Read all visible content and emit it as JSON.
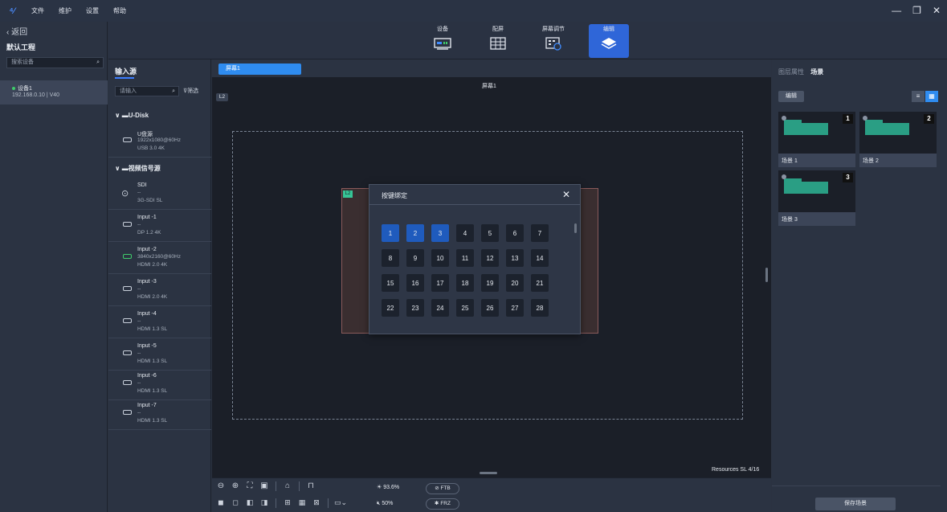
{
  "menu": {
    "items": [
      "文件",
      "维护",
      "设置",
      "帮助"
    ]
  },
  "window": {
    "minimize": "—",
    "restore": "❐",
    "close": "✕"
  },
  "left": {
    "back_label": "返回",
    "project_title": "默认工程",
    "search_placeholder": "搜索设备",
    "device": {
      "name": "设备1",
      "info": "192.168.0.10 | V40"
    }
  },
  "toolbar": {
    "tabs": [
      {
        "label": "设备"
      },
      {
        "label": "配屏"
      },
      {
        "label": "屏幕调节"
      },
      {
        "label": "编辑"
      }
    ]
  },
  "sources": {
    "title": "输入源",
    "search_placeholder": "请输入",
    "filter_label": "筛选",
    "groups": [
      {
        "label": "U-Disk"
      },
      {
        "label": "视频信号源"
      }
    ],
    "udisk": {
      "name": "U盘源",
      "line1": "1922x1080@60Hz",
      "line2": "USB 3.0 4K"
    },
    "items": [
      {
        "name": "SDI",
        "line1": "--",
        "line2": "3G-SDI SL"
      },
      {
        "name": "Input -1",
        "line1": "--",
        "line2": "DP 1.2 4K"
      },
      {
        "name": "Input -2",
        "line1": "3840x2160@60Hz",
        "line2": "HDMI 2.0 4K"
      },
      {
        "name": "Input -3",
        "line1": "--",
        "line2": "HDMI 2.0 4K"
      },
      {
        "name": "Input -4",
        "line1": "--",
        "line2": "HDMI 1.3 SL"
      },
      {
        "name": "Input -5",
        "line1": "--",
        "line2": "HDMI 1.3 SL"
      },
      {
        "name": "Input -6",
        "line1": "--",
        "line2": "HDMI 1.3 SL"
      },
      {
        "name": "Input -7",
        "line1": "--",
        "line2": "HDMI 1.3 SL"
      }
    ]
  },
  "canvas": {
    "tab_label": "屏幕1",
    "screen_name": "屏幕1",
    "layer_badge": "L2",
    "layer_tag": "L2",
    "resources": "Resources SL  4/16"
  },
  "dialog": {
    "title": "按键绑定",
    "close": "✕",
    "keys": [
      "1",
      "2",
      "3",
      "4",
      "5",
      "6",
      "7",
      "8",
      "9",
      "10",
      "11",
      "12",
      "13",
      "14",
      "15",
      "16",
      "17",
      "18",
      "19",
      "20",
      "21",
      "22",
      "23",
      "24",
      "25",
      "26",
      "27",
      "28"
    ],
    "selected": [
      1,
      2,
      3
    ]
  },
  "bottom": {
    "brightness": "93.6%",
    "volume": "50%",
    "ftb": "FTB",
    "frz": "FRZ"
  },
  "right": {
    "tab_layer": "图层属性",
    "tab_scene": "场景",
    "edit_label": "编辑",
    "scenes": [
      {
        "num": "1",
        "name": "场景 1"
      },
      {
        "num": "2",
        "name": "场景 2"
      },
      {
        "num": "3",
        "name": "场景 3"
      }
    ],
    "save_label": "保存场景"
  },
  "colors": {
    "accent": "#2f8cf0",
    "active_tool": "#2f66d8",
    "selected_key": "#1f5bbd",
    "online": "#3fcc6a",
    "layer": "#36c596"
  }
}
